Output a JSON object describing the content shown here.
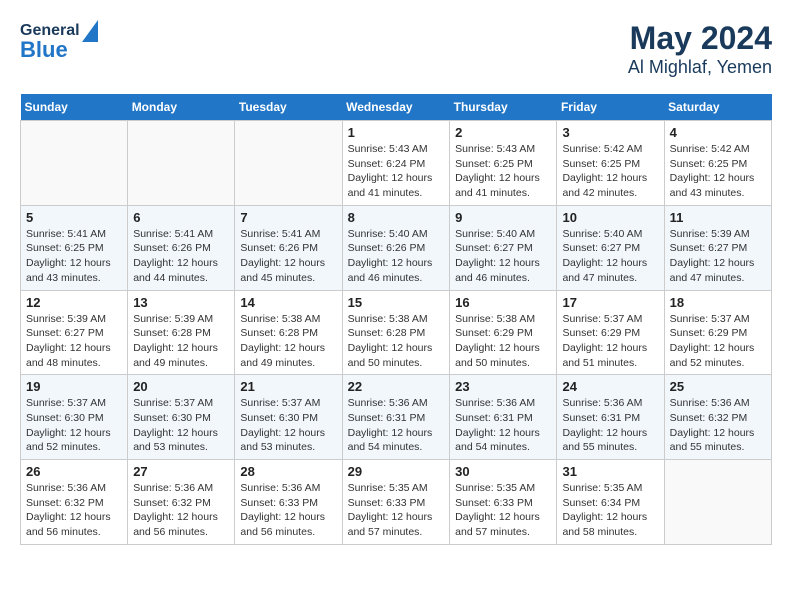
{
  "header": {
    "logo_general": "General",
    "logo_blue": "Blue",
    "month": "May 2024",
    "location": "Al Mighlaf, Yemen"
  },
  "days_of_week": [
    "Sunday",
    "Monday",
    "Tuesday",
    "Wednesday",
    "Thursday",
    "Friday",
    "Saturday"
  ],
  "weeks": [
    [
      {
        "day": "",
        "info": ""
      },
      {
        "day": "",
        "info": ""
      },
      {
        "day": "",
        "info": ""
      },
      {
        "day": "1",
        "info": "Sunrise: 5:43 AM\nSunset: 6:24 PM\nDaylight: 12 hours\nand 41 minutes."
      },
      {
        "day": "2",
        "info": "Sunrise: 5:43 AM\nSunset: 6:25 PM\nDaylight: 12 hours\nand 41 minutes."
      },
      {
        "day": "3",
        "info": "Sunrise: 5:42 AM\nSunset: 6:25 PM\nDaylight: 12 hours\nand 42 minutes."
      },
      {
        "day": "4",
        "info": "Sunrise: 5:42 AM\nSunset: 6:25 PM\nDaylight: 12 hours\nand 43 minutes."
      }
    ],
    [
      {
        "day": "5",
        "info": "Sunrise: 5:41 AM\nSunset: 6:25 PM\nDaylight: 12 hours\nand 43 minutes."
      },
      {
        "day": "6",
        "info": "Sunrise: 5:41 AM\nSunset: 6:26 PM\nDaylight: 12 hours\nand 44 minutes."
      },
      {
        "day": "7",
        "info": "Sunrise: 5:41 AM\nSunset: 6:26 PM\nDaylight: 12 hours\nand 45 minutes."
      },
      {
        "day": "8",
        "info": "Sunrise: 5:40 AM\nSunset: 6:26 PM\nDaylight: 12 hours\nand 46 minutes."
      },
      {
        "day": "9",
        "info": "Sunrise: 5:40 AM\nSunset: 6:27 PM\nDaylight: 12 hours\nand 46 minutes."
      },
      {
        "day": "10",
        "info": "Sunrise: 5:40 AM\nSunset: 6:27 PM\nDaylight: 12 hours\nand 47 minutes."
      },
      {
        "day": "11",
        "info": "Sunrise: 5:39 AM\nSunset: 6:27 PM\nDaylight: 12 hours\nand 47 minutes."
      }
    ],
    [
      {
        "day": "12",
        "info": "Sunrise: 5:39 AM\nSunset: 6:27 PM\nDaylight: 12 hours\nand 48 minutes."
      },
      {
        "day": "13",
        "info": "Sunrise: 5:39 AM\nSunset: 6:28 PM\nDaylight: 12 hours\nand 49 minutes."
      },
      {
        "day": "14",
        "info": "Sunrise: 5:38 AM\nSunset: 6:28 PM\nDaylight: 12 hours\nand 49 minutes."
      },
      {
        "day": "15",
        "info": "Sunrise: 5:38 AM\nSunset: 6:28 PM\nDaylight: 12 hours\nand 50 minutes."
      },
      {
        "day": "16",
        "info": "Sunrise: 5:38 AM\nSunset: 6:29 PM\nDaylight: 12 hours\nand 50 minutes."
      },
      {
        "day": "17",
        "info": "Sunrise: 5:37 AM\nSunset: 6:29 PM\nDaylight: 12 hours\nand 51 minutes."
      },
      {
        "day": "18",
        "info": "Sunrise: 5:37 AM\nSunset: 6:29 PM\nDaylight: 12 hours\nand 52 minutes."
      }
    ],
    [
      {
        "day": "19",
        "info": "Sunrise: 5:37 AM\nSunset: 6:30 PM\nDaylight: 12 hours\nand 52 minutes."
      },
      {
        "day": "20",
        "info": "Sunrise: 5:37 AM\nSunset: 6:30 PM\nDaylight: 12 hours\nand 53 minutes."
      },
      {
        "day": "21",
        "info": "Sunrise: 5:37 AM\nSunset: 6:30 PM\nDaylight: 12 hours\nand 53 minutes."
      },
      {
        "day": "22",
        "info": "Sunrise: 5:36 AM\nSunset: 6:31 PM\nDaylight: 12 hours\nand 54 minutes."
      },
      {
        "day": "23",
        "info": "Sunrise: 5:36 AM\nSunset: 6:31 PM\nDaylight: 12 hours\nand 54 minutes."
      },
      {
        "day": "24",
        "info": "Sunrise: 5:36 AM\nSunset: 6:31 PM\nDaylight: 12 hours\nand 55 minutes."
      },
      {
        "day": "25",
        "info": "Sunrise: 5:36 AM\nSunset: 6:32 PM\nDaylight: 12 hours\nand 55 minutes."
      }
    ],
    [
      {
        "day": "26",
        "info": "Sunrise: 5:36 AM\nSunset: 6:32 PM\nDaylight: 12 hours\nand 56 minutes."
      },
      {
        "day": "27",
        "info": "Sunrise: 5:36 AM\nSunset: 6:32 PM\nDaylight: 12 hours\nand 56 minutes."
      },
      {
        "day": "28",
        "info": "Sunrise: 5:36 AM\nSunset: 6:33 PM\nDaylight: 12 hours\nand 56 minutes."
      },
      {
        "day": "29",
        "info": "Sunrise: 5:35 AM\nSunset: 6:33 PM\nDaylight: 12 hours\nand 57 minutes."
      },
      {
        "day": "30",
        "info": "Sunrise: 5:35 AM\nSunset: 6:33 PM\nDaylight: 12 hours\nand 57 minutes."
      },
      {
        "day": "31",
        "info": "Sunrise: 5:35 AM\nSunset: 6:34 PM\nDaylight: 12 hours\nand 58 minutes."
      },
      {
        "day": "",
        "info": ""
      }
    ]
  ]
}
